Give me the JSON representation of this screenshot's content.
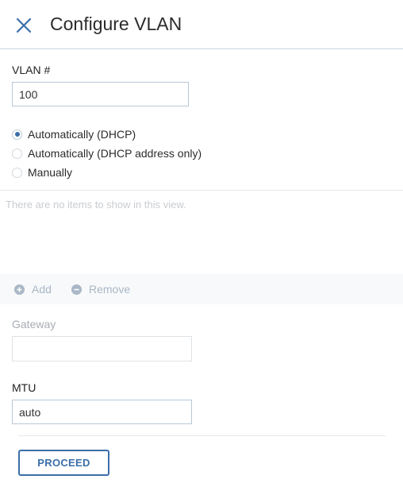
{
  "dialog": {
    "title": "Configure VLAN",
    "close_icon": "close-icon"
  },
  "vlan": {
    "label": "VLAN #",
    "value": "100"
  },
  "ip_mode": {
    "options": [
      {
        "label": "Automatically (DHCP)",
        "selected": true
      },
      {
        "label": "Automatically (DHCP address only)",
        "selected": false
      },
      {
        "label": "Manually",
        "selected": false
      }
    ]
  },
  "address_list": {
    "empty_message": "There are no items to show in this view.",
    "add_label": "Add",
    "add_icon": "plus-circle-icon",
    "remove_label": "Remove",
    "remove_icon": "minus-circle-icon"
  },
  "gateway": {
    "label": "Gateway",
    "value": ""
  },
  "mtu": {
    "label": "MTU",
    "value": "auto"
  },
  "footer": {
    "proceed_label": "PROCEED"
  },
  "colors": {
    "accent": "#3a6ea8",
    "disabled_text": "#a9b7c6"
  }
}
